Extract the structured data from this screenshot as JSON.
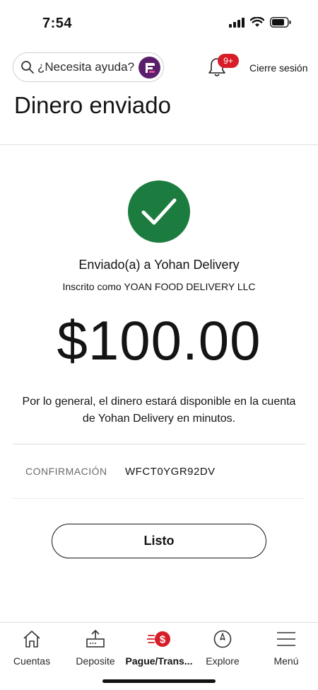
{
  "status_bar": {
    "time": "7:54"
  },
  "header": {
    "search_placeholder": "¿Necesita ayuda?",
    "notification_badge": "9+",
    "signout_label": "Cierre sesión"
  },
  "page": {
    "title": "Dinero enviado"
  },
  "confirmation": {
    "sent_to": "Enviado(a) a Yohan Delivery",
    "enrolled_as": "Inscrito como YOAN FOOD DELIVERY LLC",
    "amount": "$100.00",
    "note_line1": "Por lo general, el dinero estará disponible en la cuenta",
    "note_line2": "de Yohan Delivery en minutos.",
    "label": "CONFIRMACIÓN",
    "code": "WFCT0YGR92DV",
    "done_label": "Listo"
  },
  "bottom_nav": {
    "items": [
      {
        "label": "Cuentas",
        "icon": "home-icon",
        "active": false
      },
      {
        "label": "Deposite",
        "icon": "deposit-icon",
        "active": false
      },
      {
        "label": "Pague/Trans...",
        "icon": "pay-transfer-icon",
        "active": true
      },
      {
        "label": "Explore",
        "icon": "compass-icon",
        "active": false
      },
      {
        "label": "Menú",
        "icon": "menu-icon",
        "active": false
      }
    ]
  },
  "colors": {
    "success_green": "#1c7c3f",
    "brand_red": "#d71e28",
    "fargo_purple": "#5a1f6b"
  }
}
